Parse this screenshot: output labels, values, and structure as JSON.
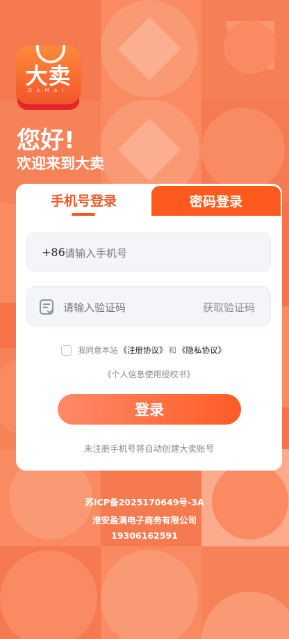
{
  "app": {
    "logo_text": "大卖",
    "logo_subtext": "DAMAI",
    "greeting": "您好!",
    "welcome": "欢迎来到大卖"
  },
  "tabs": {
    "phone_login": "手机号登录",
    "password_login": "密码登录"
  },
  "form": {
    "country_code": "+86",
    "phone_placeholder": "请输入手机号",
    "phone_value": "",
    "code_placeholder": "请输入验证码",
    "code_value": "",
    "get_code": "获取验证码"
  },
  "agreement": {
    "prefix": "我同意本站",
    "register_link": "《注册协议》",
    "and": "和",
    "privacy_link": "《隐私协议》",
    "personal_info_link": "《个人信息使用授权书》",
    "checked": false
  },
  "login_button": "登录",
  "hint": "未注册手机号将自动创建大卖账号",
  "footer": {
    "icp": "苏ICP备2025170649号-3A",
    "company": "淮安盈满电子商务有限公司",
    "phone": "19306162591"
  },
  "colors": {
    "background": "#F7744A",
    "accent": "#F25824",
    "active_tab_bg": "#FF5A1E"
  },
  "icons": {
    "code_icon": "verification-code-icon",
    "logo": "shopping-bag-logo"
  }
}
